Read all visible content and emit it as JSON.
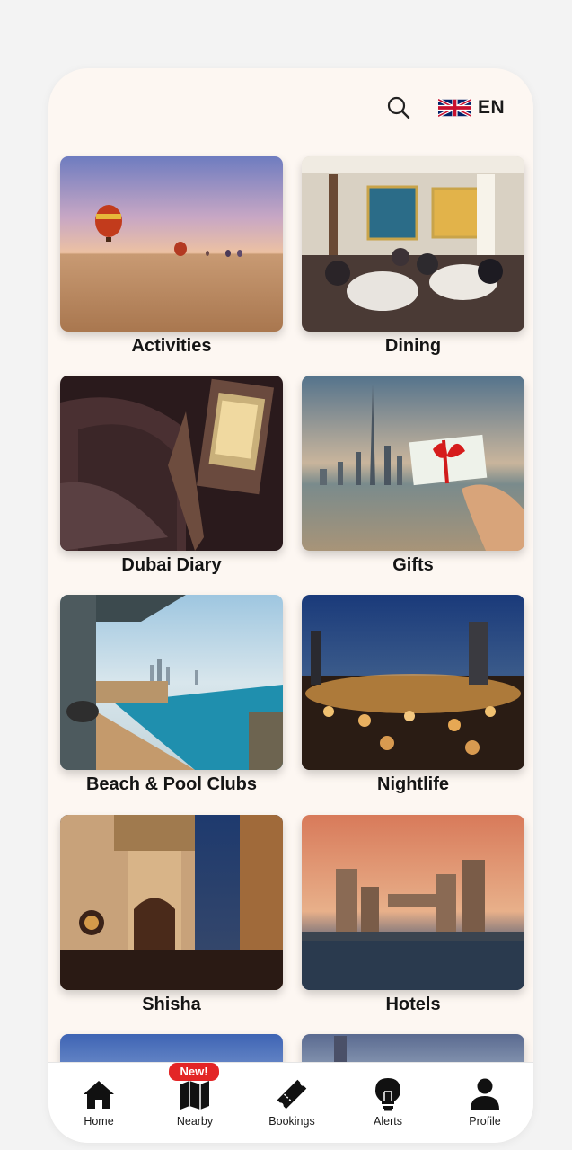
{
  "header": {
    "search_icon": "search-icon",
    "language": {
      "flag": "uk-flag-icon",
      "code": "EN"
    }
  },
  "categories": [
    {
      "label": "Activities"
    },
    {
      "label": "Dining"
    },
    {
      "label": "Dubai Diary"
    },
    {
      "label": "Gifts"
    },
    {
      "label": "Beach & Pool Clubs"
    },
    {
      "label": "Nightlife"
    },
    {
      "label": "Shisha"
    },
    {
      "label": "Hotels"
    }
  ],
  "bottom_nav": {
    "badge": "New!",
    "items": [
      {
        "label": "Home",
        "icon": "home-icon"
      },
      {
        "label": "Nearby",
        "icon": "map-icon"
      },
      {
        "label": "Bookings",
        "icon": "ticket-icon"
      },
      {
        "label": "Alerts",
        "icon": "bulb-icon"
      },
      {
        "label": "Profile",
        "icon": "person-icon"
      }
    ]
  },
  "colors": {
    "background": "#f3f3f3",
    "card": "#fdf7f2",
    "badge": "#e32526",
    "text": "#151515"
  }
}
